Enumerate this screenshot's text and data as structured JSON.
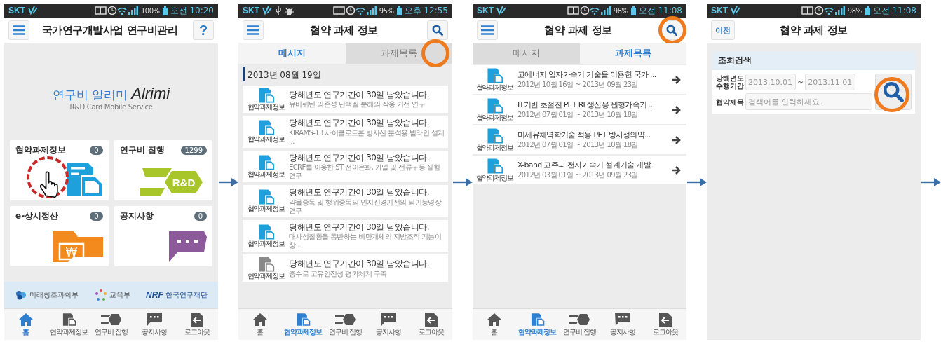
{
  "screens": [
    {
      "kind": "home",
      "status_bar": {
        "carrier": "SKT",
        "battery": "100%",
        "time": "오전 10:20"
      },
      "header": {
        "title": "국가연구개발사업 연구비관리",
        "left": {
          "kind": "menu"
        },
        "right": {
          "kind": "help",
          "label": "?"
        }
      },
      "logo": {
        "korean": "연구비 알리미",
        "latin": "Alrimi",
        "tagline": "R&D Card Mobile Service"
      },
      "tiles": [
        {
          "kind": "project",
          "label": "협약과제정보",
          "count": "0",
          "highlighted": true
        },
        {
          "kind": "budget",
          "label": "연구비 집행",
          "count": "1299",
          "icon_text": "R&D",
          "highlighted": false
        },
        {
          "kind": "settlement",
          "label": "e-상시정산",
          "count": "0",
          "icon_text": "₩",
          "highlighted": false
        },
        {
          "kind": "notice",
          "label": "공지사항",
          "count": "0",
          "highlighted": false
        }
      ],
      "sponsors": [
        {
          "kind": "msip",
          "name": "미래창조과학부"
        },
        {
          "kind": "moe",
          "name": "교육부"
        },
        {
          "kind": "nrf",
          "name": "NRF",
          "subname": "한국연구재단"
        }
      ],
      "tab_bar": [
        {
          "kind": "home",
          "label": "홈",
          "selected": true
        },
        {
          "kind": "project",
          "label": "협약과제정보",
          "selected": false
        },
        {
          "kind": "budget",
          "label": "연구비 집행",
          "selected": false
        },
        {
          "kind": "notice",
          "label": "공지사항",
          "selected": false
        },
        {
          "kind": "logout",
          "label": "로그아웃",
          "selected": false
        }
      ]
    },
    {
      "kind": "messages",
      "status_bar": {
        "carrier": "SKT",
        "notification_icons": [
          {
            "kind": "usb"
          },
          {
            "kind": "bug"
          }
        ],
        "battery": "95%",
        "time": "오후 12:55"
      },
      "header": {
        "title": "협약 과제 정보",
        "left": {
          "kind": "menu"
        },
        "right": {
          "kind": "search"
        }
      },
      "tabs": [
        {
          "label": "메시지",
          "selected": true,
          "highlighted": false
        },
        {
          "label": "과제목록",
          "selected": false,
          "highlighted": true
        }
      ],
      "date": "2013년 08월 19일",
      "messages": [
        {
          "icon_label": "협약과제정보",
          "title": "당해년도 연구기간이 30일 남았습니다.",
          "subtitle": "유비퀴틴 의존성 단백질 분해의 작용 기전 연구",
          "read": false
        },
        {
          "icon_label": "협약과제정보",
          "title": "당해년도 연구기간이 30일 남았습니다.",
          "subtitle": "KIRAMS-13 사이클로트론 방사선 분석용 빔라인 설계 ...",
          "read": false
        },
        {
          "icon_label": "협약과제정보",
          "title": "당해년도 연구기간이 30일 남았습니다.",
          "subtitle": "ECRF를 이용한 ST 전이온화, 가열 및 전류구동 실험 연구",
          "read": false
        },
        {
          "icon_label": "협약과제정보",
          "title": "당해년도 연구기간이 30일 남았습니다.",
          "subtitle": "약물중독 및 행위중독의 인지신경기전의 뇌기능영상연구",
          "read": false
        },
        {
          "icon_label": "협약과제정보",
          "title": "당해년도 연구기간이 30일 남았습니다.",
          "subtitle": "대사성질환을 동반하는 비만개체의 지방조직 기능이상 ...",
          "read": false
        },
        {
          "icon_label": "협약과제정보",
          "title": "당해년도 연구기간이 30일 남았습니다.",
          "subtitle": "중수로 고유안전성 평가체계 구축",
          "read": true
        }
      ],
      "tab_bar": [
        {
          "kind": "home",
          "label": "홈",
          "selected": false
        },
        {
          "kind": "project",
          "label": "협약과제정보",
          "selected": true
        },
        {
          "kind": "budget",
          "label": "연구비 집행",
          "selected": false
        },
        {
          "kind": "notice",
          "label": "공지사항",
          "selected": false
        },
        {
          "kind": "logout",
          "label": "로그아웃",
          "selected": false
        }
      ]
    },
    {
      "kind": "projects",
      "status_bar": {
        "carrier": "SKT",
        "battery": "98%",
        "time": "오전 11:08"
      },
      "header": {
        "title": "협약 과제 정보",
        "left": {
          "kind": "menu"
        },
        "right": {
          "kind": "search",
          "highlighted": true
        }
      },
      "tabs": [
        {
          "label": "메시지",
          "selected": false,
          "highlighted": false
        },
        {
          "label": "과제목록",
          "selected": true,
          "highlighted": false
        }
      ],
      "projects": [
        {
          "icon_label": "협약과제정보",
          "title": "고에너지 입자가속기 기술을 이용한 국가 ...",
          "period": "2012년 10월 16일 ~ 2013년 09월 23일"
        },
        {
          "icon_label": "협약과제정보",
          "title": "IT기반 초절전 PET RI 생산용 원형가속기 ...",
          "period": "2012년 07월 01일 ~ 2013년 10월 18일"
        },
        {
          "icon_label": "협약과제정보",
          "title": "미세유체역학기술 적용 PET 방사성의약...",
          "period": "2012년 07월 01일 ~ 2013년 10월 18일"
        },
        {
          "icon_label": "협약과제정보",
          "title": "X-band 고주파 전자가속기 설계기술 개발",
          "period": "2012년 03월 01일 ~ 2013년 09월 23일"
        }
      ],
      "tab_bar": [
        {
          "kind": "home",
          "label": "홈",
          "selected": false
        },
        {
          "kind": "project",
          "label": "협약과제정보",
          "selected": true
        },
        {
          "kind": "budget",
          "label": "연구비 집행",
          "selected": false
        },
        {
          "kind": "notice",
          "label": "공지사항",
          "selected": false
        },
        {
          "kind": "logout",
          "label": "로그아웃",
          "selected": false
        }
      ]
    },
    {
      "kind": "search",
      "status_bar": {
        "carrier": "SKT",
        "battery": "98%",
        "time": "오전 11:08"
      },
      "header": {
        "title": "협약 과제 정보",
        "left": {
          "kind": "back",
          "label": "이전"
        }
      },
      "search_panel": {
        "title": "조회검색",
        "period_label": "당해년도 수행기간",
        "from": "2013.10.01",
        "separator": "~",
        "to": "2013.11.01",
        "keyword_label": "협약제목",
        "keyword_placeholder": "검색어를 입력하세요.",
        "search_button_highlighted": true
      }
    }
  ]
}
